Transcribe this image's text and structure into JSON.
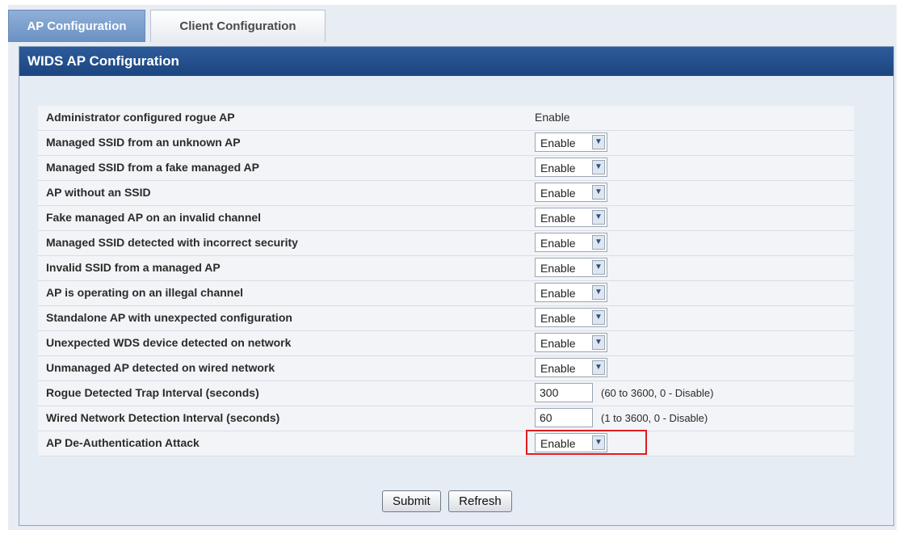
{
  "tabs": [
    {
      "label": "AP Configuration",
      "active": true
    },
    {
      "label": "Client Configuration",
      "active": false
    }
  ],
  "panel": {
    "title": "WIDS AP Configuration"
  },
  "rows": [
    {
      "label": "Administrator configured rogue AP",
      "value": "Enable"
    },
    {
      "label": "Managed SSID from an unknown AP",
      "value": "Enable"
    },
    {
      "label": "Managed SSID from a fake managed AP",
      "value": "Enable"
    },
    {
      "label": "AP without an SSID",
      "value": "Enable"
    },
    {
      "label": "Fake managed AP on an invalid channel",
      "value": "Enable"
    },
    {
      "label": "Managed SSID detected with incorrect security",
      "value": "Enable"
    },
    {
      "label": "Invalid SSID from a managed AP",
      "value": "Enable"
    },
    {
      "label": "AP is operating on an illegal channel",
      "value": "Enable"
    },
    {
      "label": "Standalone AP with unexpected configuration",
      "value": "Enable"
    },
    {
      "label": "Unexpected WDS device detected on network",
      "value": "Enable"
    },
    {
      "label": "Unmanaged AP detected on wired network",
      "value": "Enable"
    },
    {
      "label": "Rogue Detected Trap Interval (seconds)",
      "value": "300",
      "range": "(60 to 3600, 0 - Disable)"
    },
    {
      "label": "Wired Network Detection Interval (seconds)",
      "value": "60",
      "range": "(1 to 3600, 0 - Disable)"
    },
    {
      "label": "AP De-Authentication Attack",
      "value": "Enable"
    }
  ],
  "buttons": {
    "submit": "Submit",
    "refresh": "Refresh"
  },
  "colors": {
    "title_bar": "#1c4580",
    "highlight": "#e01b24",
    "active_tab": "#6b91c4"
  }
}
